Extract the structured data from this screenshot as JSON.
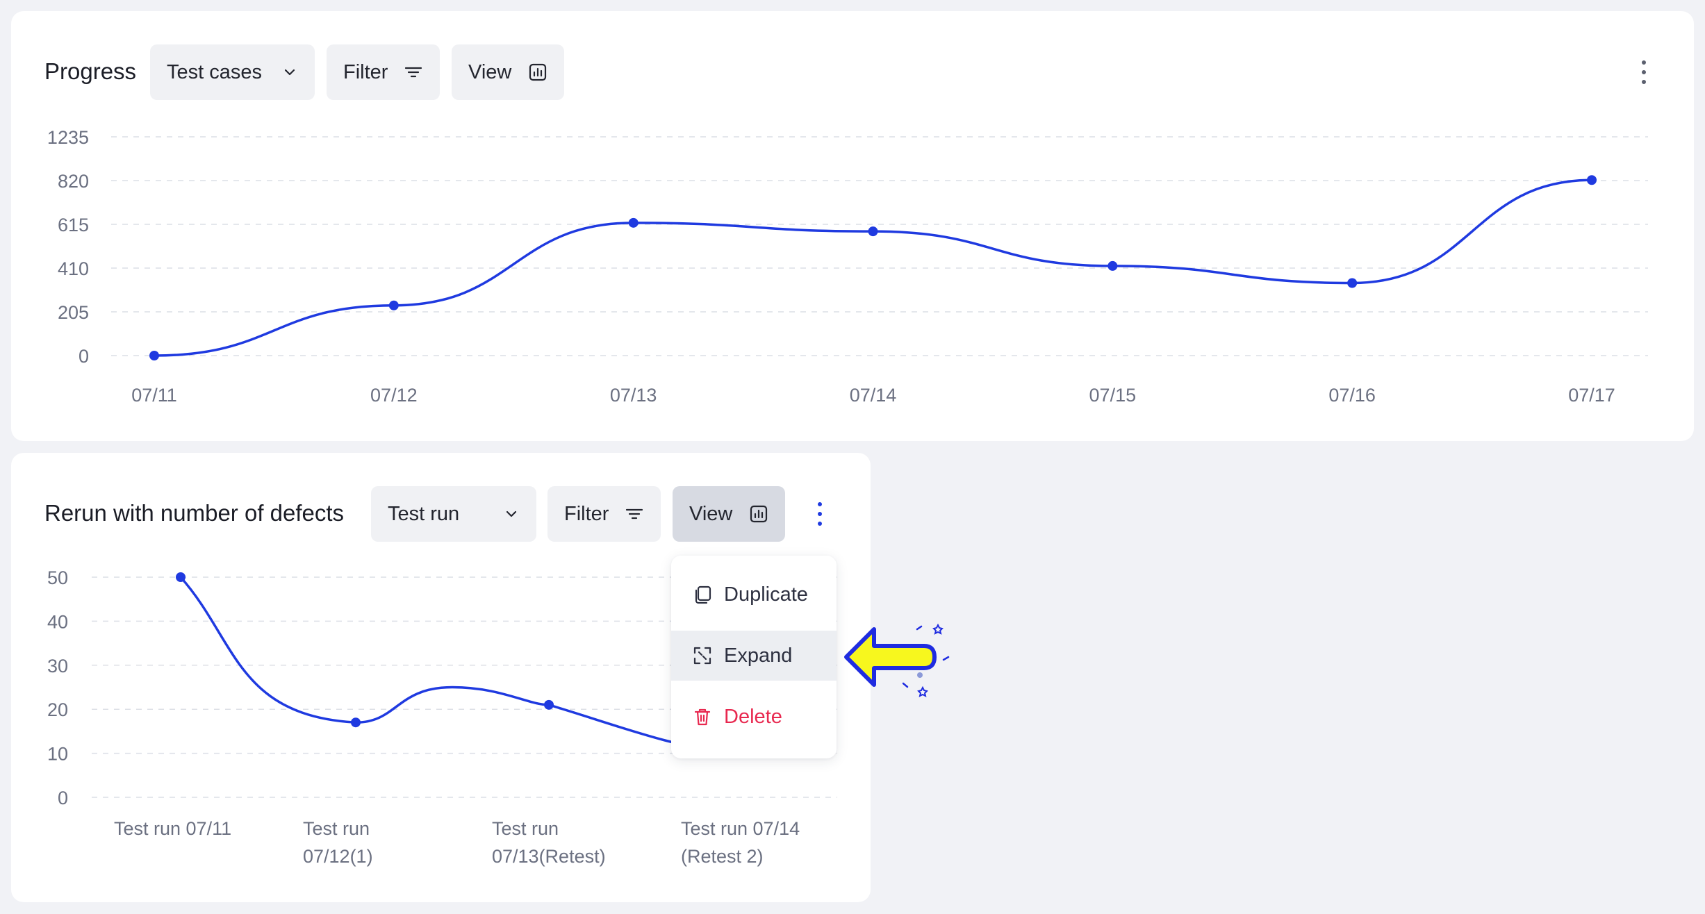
{
  "progress_card": {
    "title": "Progress",
    "dropdown_label": "Test cases",
    "filter_label": "Filter",
    "view_label": "View",
    "chart_data": {
      "type": "line",
      "categories": [
        "07/11",
        "07/12",
        "07/13",
        "07/14",
        "07/15",
        "07/16",
        "07/17"
      ],
      "series": [
        {
          "values": [
            0,
            235,
            622,
            582,
            420,
            340,
            825
          ]
        }
      ],
      "y_ticks": [
        1235,
        820,
        615,
        410,
        205,
        0
      ],
      "ylim": [
        0,
        1235
      ],
      "grid": true,
      "line_color": "#1f3ae0"
    }
  },
  "rerun_card": {
    "title": "Rerun with number of defects",
    "dropdown_label": "Test run",
    "filter_label": "Filter",
    "view_label": "View",
    "chart_data": {
      "type": "line",
      "categories": [
        [
          "Test run 07/11"
        ],
        [
          "Test run",
          "07/12(1)"
        ],
        [
          "Test run",
          "07/13(Retest)"
        ],
        [
          "Test run 07/14",
          "(Retest 2)"
        ]
      ],
      "series": [
        {
          "values": [
            50,
            17,
            21,
            10
          ]
        }
      ],
      "y_ticks": [
        50,
        40,
        30,
        20,
        10,
        0
      ],
      "ylim": [
        0,
        50
      ],
      "grid": true,
      "line_color": "#1f3ae0"
    }
  },
  "menu": {
    "items": [
      {
        "label": "Duplicate",
        "icon": "duplicate-icon"
      },
      {
        "label": "Expand",
        "icon": "expand-icon"
      },
      {
        "label": "Delete",
        "icon": "trash-icon"
      }
    ]
  },
  "colors": {
    "accent": "#1f3ae0",
    "danger": "#e8284f",
    "highlight_arrow": "#f7f71e"
  }
}
